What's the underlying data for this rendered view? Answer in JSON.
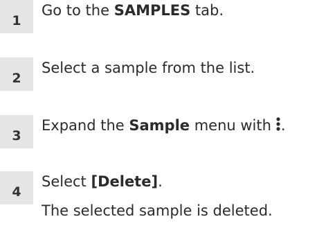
{
  "steps": [
    {
      "number": "1",
      "pre": "Go to the ",
      "bold": "SAMPLES",
      "post": " tab."
    },
    {
      "number": "2",
      "text": "Select a sample from the list."
    },
    {
      "number": "3",
      "pre": "Expand the ",
      "bold": "Sample",
      "post": " menu with",
      "icon": "more-vertical-icon",
      "tail": "."
    },
    {
      "number": "4",
      "pre": "Select ",
      "bold": "[Delete]",
      "post": "."
    }
  ],
  "result": "The selected sample is deleted."
}
